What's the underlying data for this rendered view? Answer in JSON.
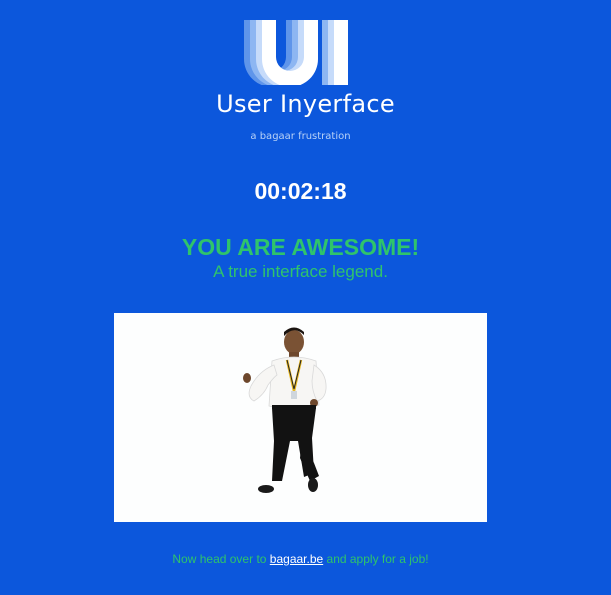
{
  "brand": {
    "logo_text": "UI",
    "name": "User Inyerface",
    "tagline": "a bagaar frustration"
  },
  "timer": {
    "value": "00:02:18"
  },
  "result": {
    "headline": "YOU ARE AWESOME!",
    "subline": "A true interface legend."
  },
  "footer": {
    "prefix": "Now head over to",
    "link_text": "bagaar.be",
    "suffix": "and apply for a job!"
  },
  "colors": {
    "background": "#0c57dc",
    "success_green": "#2fc46b",
    "white": "#ffffff"
  }
}
